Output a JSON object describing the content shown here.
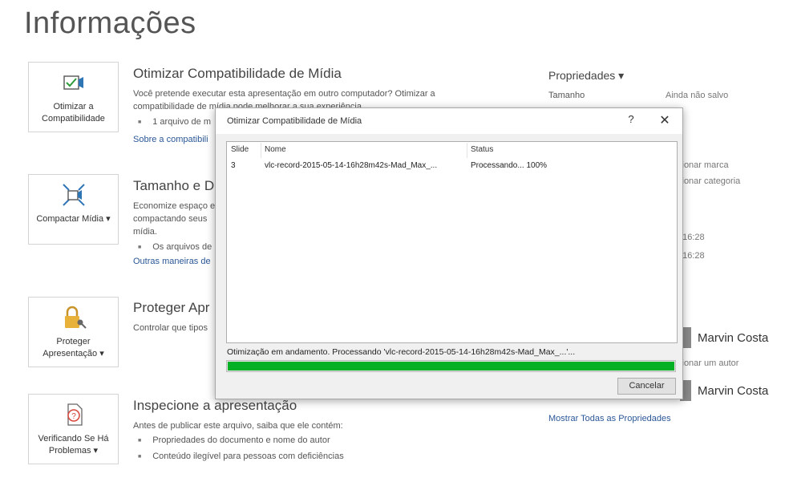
{
  "page": {
    "title": "Informações"
  },
  "sections": [
    {
      "tile_label": "Otimizar a Compatibilidade",
      "icon": "film-check-icon",
      "title": "Otimizar Compatibilidade de Mídia",
      "text": "Você pretende executar esta apresentação em outro computador? Otimizar a compatibilidade de mídia pode melhorar a sua experiência.",
      "bullet": "1 arquivo de m",
      "link": "Sobre a compatibili"
    },
    {
      "tile_label": "Compactar Mídia ▾",
      "icon": "compress-media-icon",
      "title": "Tamanho e D",
      "text_lines": [
        "Economize espaço e",
        "compactando seus",
        "mídia."
      ],
      "bullet": "Os arquivos de",
      "link": "Outras maneiras de"
    },
    {
      "tile_label": "Proteger Apresentação ▾",
      "icon": "lock-key-icon",
      "title": "Proteger Apr",
      "text": "Controlar que tipos"
    },
    {
      "tile_label": "Verificando Se Há Problemas ▾",
      "icon": "inspect-document-icon",
      "title": "Inspecione a apresentação",
      "text": "Antes de publicar este arquivo, saiba que ele contém:",
      "bullets": [
        "Propriedades do documento e nome do autor",
        "Conteúdo ilegível para pessoas com deficiências"
      ]
    }
  ],
  "properties": {
    "heading": "Propriedades ▾",
    "rows": [
      {
        "key": "Tamanho",
        "value": "Ainda não salvo"
      }
    ],
    "partial_values": [
      "cionar marca",
      "cionar categoria",
      ", 16:28",
      ", 16:28",
      "cionar um autor"
    ],
    "people": [
      "Marvin Costa",
      "Marvin Costa"
    ],
    "show_all_link": "Mostrar Todas as Propriedades"
  },
  "dialog": {
    "title": "Otimizar Compatibilidade de Mídia",
    "help": "?",
    "close": "✕",
    "columns": [
      "Slide",
      "Nome",
      "Status"
    ],
    "rows": [
      {
        "slide": "3",
        "name": "vlc-record-2015-05-14-16h28m42s-Mad_Max_...",
        "status": "Processando... 100%"
      }
    ],
    "status_text": "Otimização em andamento. Processando 'vlc-record-2015-05-14-16h28m42s-Mad_Max_...'...",
    "progress": 1.0,
    "progress_color": "#06b025",
    "cancel_label": "Cancelar"
  },
  "colors": {
    "link": "#2b5797",
    "accent_icon": "#2e75b6"
  }
}
